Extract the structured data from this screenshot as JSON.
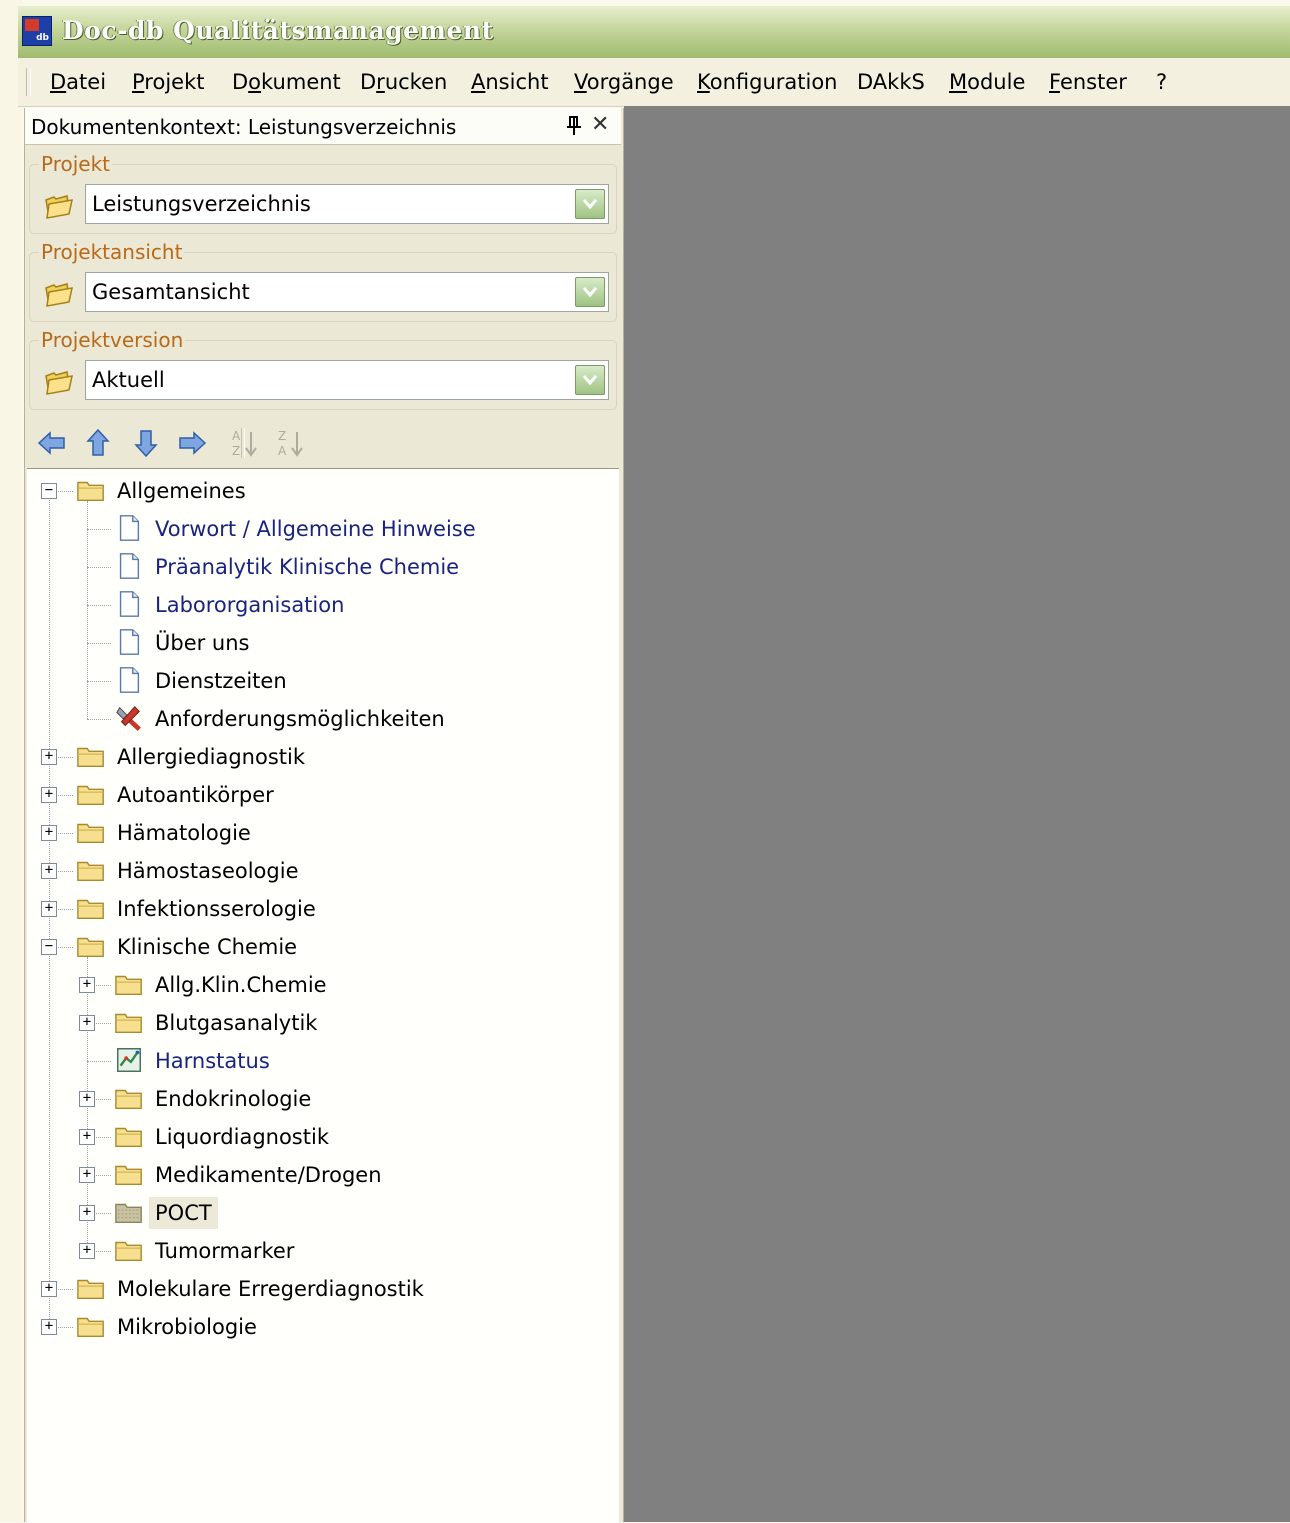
{
  "window": {
    "title": "Doc-db Qualitätsmanagement",
    "icon_text": "db"
  },
  "menu": [
    {
      "id": "datei",
      "pre": "",
      "u": "D",
      "post": "atei"
    },
    {
      "id": "projekt",
      "pre": "",
      "u": "P",
      "post": "rojekt"
    },
    {
      "id": "dokument",
      "pre": "D",
      "u": "o",
      "post": "kument"
    },
    {
      "id": "drucken",
      "pre": "D",
      "u": "r",
      "post": "ucken"
    },
    {
      "id": "ansicht",
      "pre": "",
      "u": "A",
      "post": "nsicht"
    },
    {
      "id": "vorgaenge",
      "pre": "",
      "u": "V",
      "post": "orgänge"
    },
    {
      "id": "konfiguration",
      "pre": "",
      "u": "K",
      "post": "onfiguration"
    },
    {
      "id": "dakks",
      "pre": "DAkkS",
      "u": "",
      "post": ""
    },
    {
      "id": "module",
      "pre": "",
      "u": "M",
      "post": "odule"
    },
    {
      "id": "fenster",
      "pre": "",
      "u": "F",
      "post": "enster"
    },
    {
      "id": "help",
      "pre": "?",
      "u": "",
      "post": ""
    }
  ],
  "panel": {
    "title": "Dokumentenkontext: Leistungsverzeichnis",
    "projekt": {
      "label": "Projekt",
      "value": "Leistungsverzeichnis"
    },
    "projektansicht": {
      "label": "Projektansicht",
      "value": "Gesamtansicht"
    },
    "projektversion": {
      "label": "Projektversion",
      "value": "Aktuell"
    },
    "toolbar": {
      "sort_az": "A Z",
      "sort_za": "Z A"
    }
  },
  "tree": [
    {
      "level": 0,
      "label": "Allgemeines",
      "icon": "folder-icon",
      "expander": "minus"
    },
    {
      "level": 1,
      "label": "Vorwort / Allgemeine Hinweise",
      "icon": "document-icon",
      "link": true
    },
    {
      "level": 1,
      "label": "Präanalytik Klinische Chemie",
      "icon": "document-icon",
      "link": true
    },
    {
      "level": 1,
      "label": "Labororganisation",
      "icon": "document-icon",
      "link": true
    },
    {
      "level": 1,
      "label": "Über uns",
      "icon": "document-icon"
    },
    {
      "level": 1,
      "label": "Dienstzeiten",
      "icon": "document-icon"
    },
    {
      "level": 1,
      "label": "Anforderungsmöglichkeiten",
      "icon": "tools-icon"
    },
    {
      "level": 0,
      "label": "Allergiediagnostik",
      "icon": "folder-icon",
      "expander": "plus"
    },
    {
      "level": 0,
      "label": "Autoantikörper",
      "icon": "folder-icon",
      "expander": "plus"
    },
    {
      "level": 0,
      "label": "Hämatologie",
      "icon": "folder-icon",
      "expander": "plus"
    },
    {
      "level": 0,
      "label": "Hämostaseologie",
      "icon": "folder-icon",
      "expander": "plus"
    },
    {
      "level": 0,
      "label": "Infektionsserologie",
      "icon": "folder-icon",
      "expander": "plus"
    },
    {
      "level": 0,
      "label": "Klinische Chemie",
      "icon": "folder-icon",
      "expander": "minus"
    },
    {
      "level": 1,
      "label": "Allg.Klin.Chemie",
      "icon": "folder-icon",
      "expander": "plus"
    },
    {
      "level": 1,
      "label": "Blutgasanalytik",
      "icon": "folder-icon",
      "expander": "plus"
    },
    {
      "level": 1,
      "label": "Harnstatus",
      "icon": "chart-icon",
      "link": true
    },
    {
      "level": 1,
      "label": "Endokrinologie",
      "icon": "folder-icon",
      "expander": "plus"
    },
    {
      "level": 1,
      "label": "Liquordiagnostik",
      "icon": "folder-icon",
      "expander": "plus"
    },
    {
      "level": 1,
      "label": "Medikamente/Drogen",
      "icon": "folder-icon",
      "expander": "plus"
    },
    {
      "level": 1,
      "label": "POCT",
      "icon": "folder-icon",
      "expander": "plus",
      "selected": true
    },
    {
      "level": 1,
      "label": "Tumormarker",
      "icon": "folder-icon",
      "expander": "plus"
    },
    {
      "level": 0,
      "label": "Molekulare Erregerdiagnostik",
      "icon": "folder-icon",
      "expander": "plus"
    },
    {
      "level": 0,
      "label": "Mikrobiologie",
      "icon": "folder-icon",
      "expander": "plus"
    }
  ],
  "colors": {
    "title_bar": "#9fbb6e",
    "group_label": "#b86a18",
    "link_text": "#1a237e",
    "workspace": "#808080"
  }
}
